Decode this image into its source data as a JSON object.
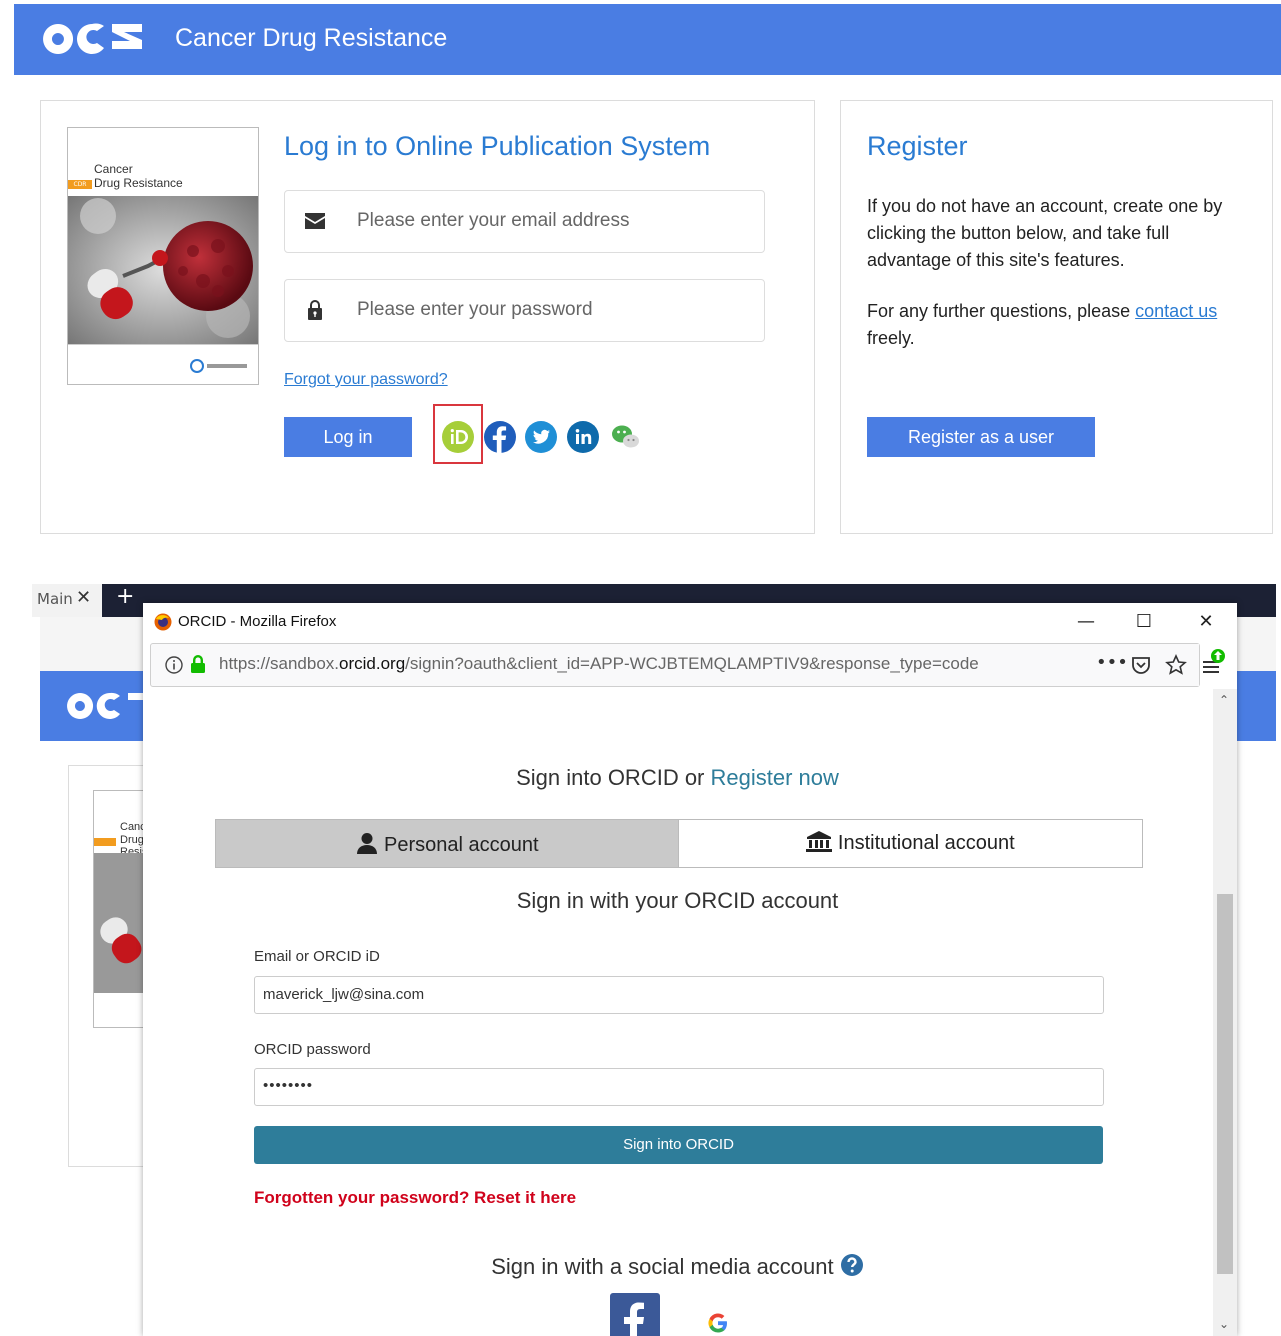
{
  "site": {
    "logo": "OAE",
    "title": "Cancer Drug Resistance"
  },
  "cover": {
    "line1": "Cancer",
    "line2": "Drug Resistance",
    "badge": "CDR"
  },
  "login": {
    "heading": "Log in to Online Publication System",
    "email_placeholder": "Please enter your email address",
    "password_placeholder": "Please enter your password",
    "forgot": "Forgot your password?",
    "button": "Log in",
    "social": [
      "orcid-icon",
      "facebook-icon",
      "twitter-icon",
      "linkedin-icon",
      "wechat-icon"
    ]
  },
  "register": {
    "heading": "Register",
    "text": "If you do not have an account, create one by clicking the button below, and take full advantage of this site's features.",
    "contact_pre": "For any further questions, please ",
    "contact_link": "contact us",
    "contact_post": " freely.",
    "button": "Register as a user"
  },
  "bg_browser": {
    "tab_label": "Main",
    "new_tab": "+"
  },
  "popup": {
    "window_title": "ORCID - Mozilla Firefox",
    "url_prefix": "https://sandbox.",
    "url_domain": "orcid.org",
    "url_rest": "/signin?oauth&client_id=APP-WCJBTEMQLAMPTIV9&response_type=code",
    "heading_pre": "Sign into ORCID or ",
    "heading_link": "Register now",
    "tab_personal": "Personal account",
    "tab_institutional": "Institutional account",
    "subheading": "Sign in with your ORCID account",
    "email_label": "Email or ORCID iD",
    "email_value": "maverick_ljw@sina.com",
    "password_label": "ORCID password",
    "password_value": "••••••••",
    "signin_button": "Sign into ORCID",
    "reset_link": "Forgotten your password? Reset it here",
    "social_heading": "Sign in with a social media account"
  }
}
